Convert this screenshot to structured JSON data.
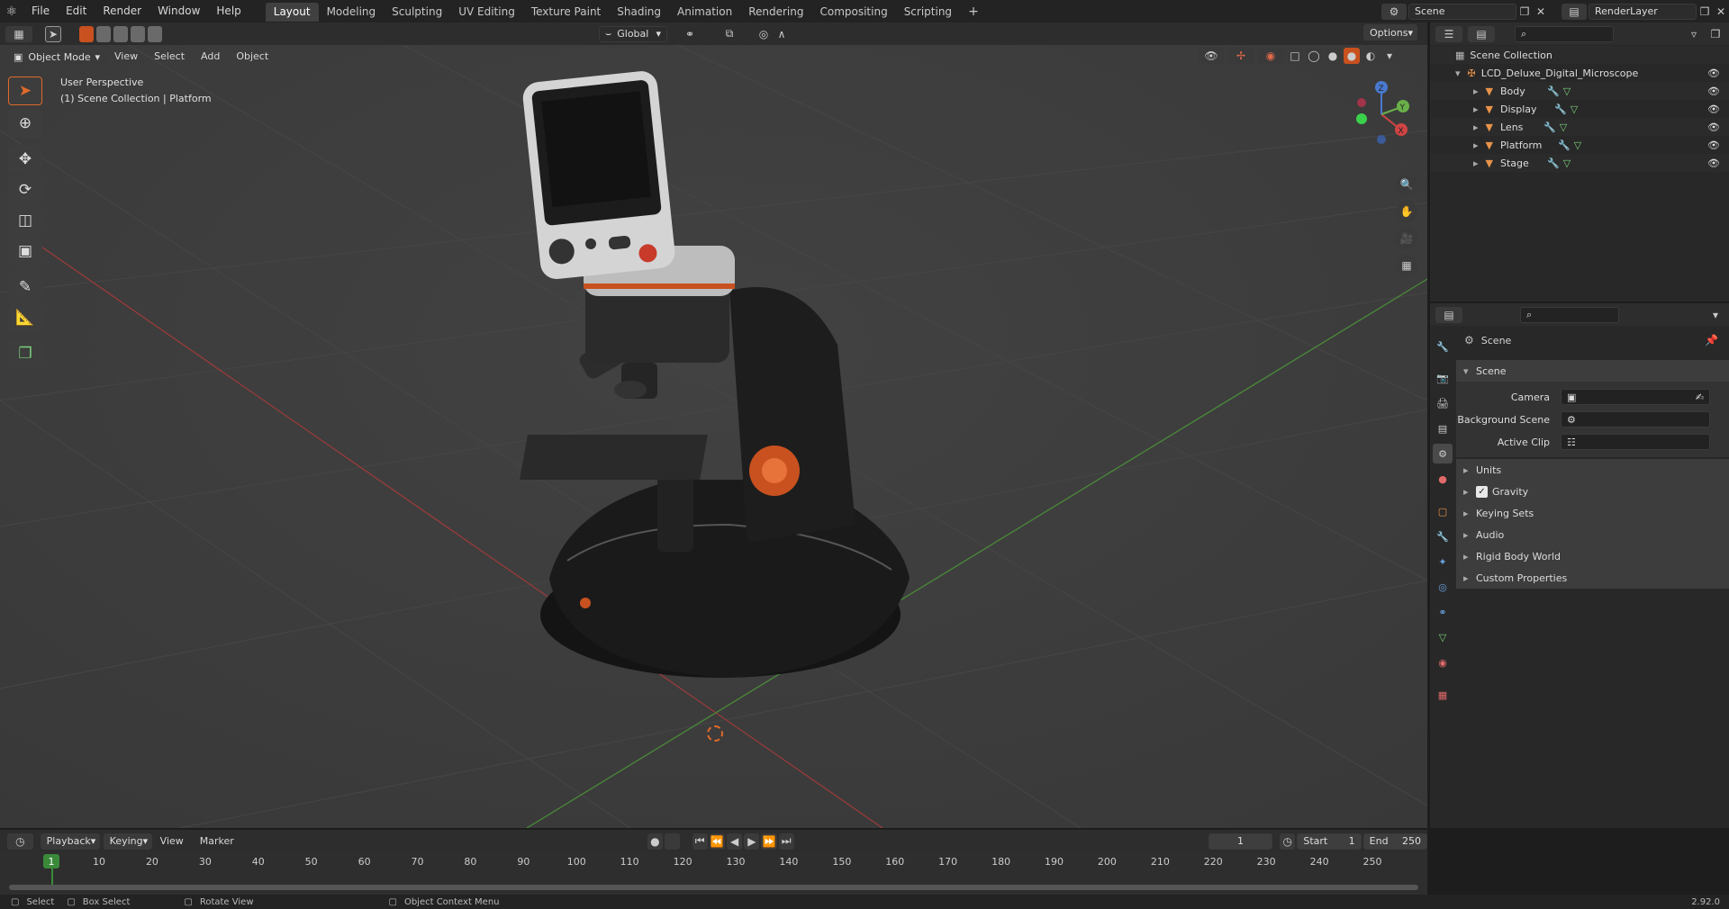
{
  "topbar": {
    "menus": [
      "File",
      "Edit",
      "Render",
      "Window",
      "Help"
    ],
    "workspaces": [
      "Layout",
      "Modeling",
      "Sculpting",
      "UV Editing",
      "Texture Paint",
      "Shading",
      "Animation",
      "Rendering",
      "Compositing",
      "Scripting"
    ],
    "active_workspace": "Layout",
    "add_tab": "+",
    "scene_name": "Scene",
    "view_layer": "RenderLayer"
  },
  "viewport": {
    "mode": "Object Mode",
    "menus": [
      "View",
      "Select",
      "Add",
      "Object"
    ],
    "orientation": "Global",
    "options_label": "Options",
    "overlay_title": "User Perspective",
    "overlay_sub": "(1) Scene Collection | Platform",
    "gizmo": {
      "x": "X",
      "y": "Y",
      "z": "Z"
    }
  },
  "outliner": {
    "root": "Scene Collection",
    "collection": "LCD_Deluxe_Digital_Microscope",
    "objects": [
      "Body",
      "Display",
      "Lens",
      "Platform",
      "Stage"
    ]
  },
  "properties": {
    "context": "Scene",
    "panel": "Scene",
    "fields": [
      {
        "label": "Camera",
        "value": ""
      },
      {
        "label": "Background Scene",
        "value": ""
      },
      {
        "label": "Active Clip",
        "value": ""
      }
    ],
    "subpanels": [
      "Units",
      "Gravity",
      "Keying Sets",
      "Audio",
      "Rigid Body World",
      "Custom Properties"
    ],
    "gravity_checked": true
  },
  "timeline": {
    "menus": [
      "Playback",
      "Keying",
      "View",
      "Marker"
    ],
    "current_frame": "1",
    "start_label": "Start",
    "start": "1",
    "end_label": "End",
    "end": "250",
    "ticks": [
      "1",
      "10",
      "20",
      "30",
      "40",
      "50",
      "60",
      "70",
      "80",
      "90",
      "100",
      "110",
      "120",
      "130",
      "140",
      "150",
      "160",
      "170",
      "180",
      "190",
      "200",
      "210",
      "220",
      "230",
      "240",
      "250"
    ]
  },
  "statusbar": {
    "items": [
      "Select",
      "Box Select",
      "Rotate View",
      "Object Context Menu"
    ],
    "version": "2.92.0"
  },
  "colors": {
    "accent": "#4a6fa8",
    "orange_icon": "#e8934a",
    "frame_green": "#3a8a3a"
  }
}
